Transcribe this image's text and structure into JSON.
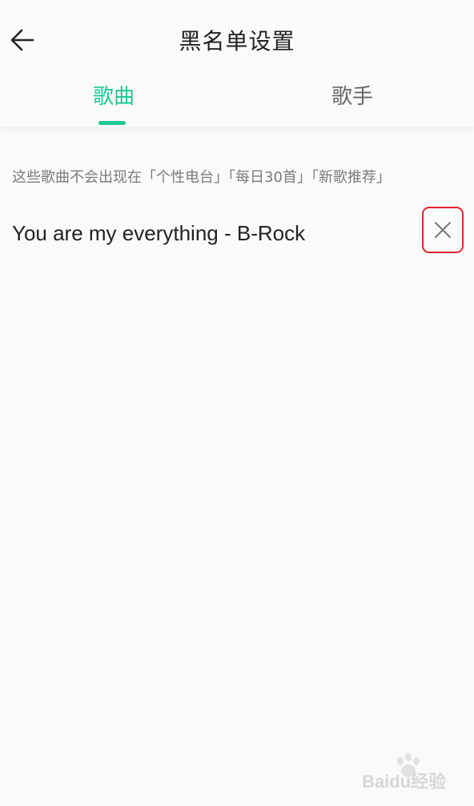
{
  "header": {
    "title": "黑名单设置",
    "back_icon": "arrow-left-icon"
  },
  "tabs": [
    {
      "label": "歌曲",
      "active": true
    },
    {
      "label": "歌手",
      "active": false
    }
  ],
  "content": {
    "hint": "这些歌曲不会出现在「个性电台」「每日30首」「新歌推荐」",
    "items": [
      {
        "title": "You are my everything - B-Rock",
        "action_icon": "close-icon"
      }
    ]
  },
  "watermark": {
    "text": "Baidu经验"
  },
  "colors": {
    "accent": "#1fc794",
    "highlight_box": "#e0242e",
    "background": "#fafafa"
  }
}
